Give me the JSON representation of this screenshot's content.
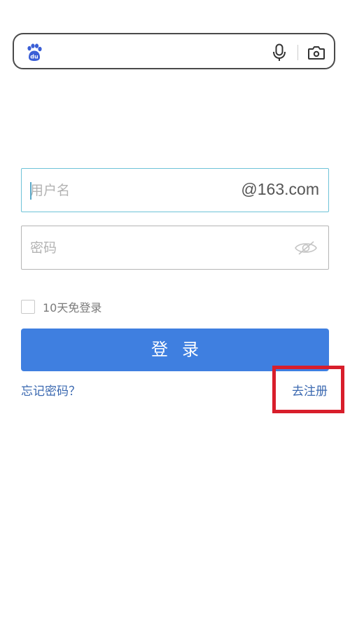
{
  "search_bar": {
    "logo_icon": "baidu-paw-icon",
    "mic_icon": "microphone-icon",
    "camera_icon": "camera-icon",
    "brand_color": "#3b5fd6"
  },
  "login_form": {
    "username": {
      "placeholder": "用户名",
      "value": "",
      "domain_suffix": "@163.com"
    },
    "password": {
      "placeholder": "密码",
      "value": "",
      "visibility_icon": "eye-slash-icon"
    },
    "remember": {
      "label": "10天免登录",
      "checked": false
    },
    "login_button_label": "登录",
    "forgot_password_link": "忘记密码？",
    "register_link": "去注册"
  },
  "colors": {
    "primary_button": "#3f7fe0",
    "link": "#3a68b0",
    "highlight_box": "#d81e2b",
    "focused_border": "#6ec3d8"
  }
}
